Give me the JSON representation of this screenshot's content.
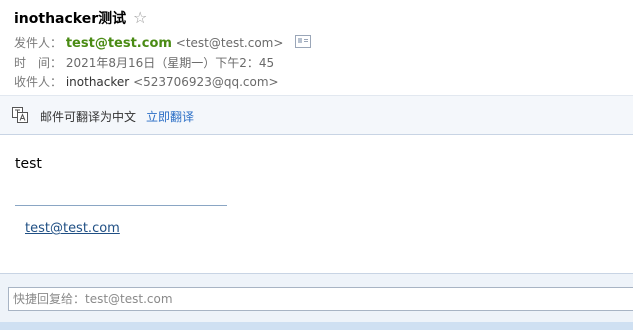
{
  "email": {
    "subject": "inothacker测试",
    "star_glyph": "☆",
    "from_label": "发件人：",
    "from_name": "test@test.com",
    "from_address": "<test@test.com>",
    "time_label": "时　间：",
    "time_value": "2021年8月16日（星期一）下午2：45",
    "to_label": "收件人：",
    "to_name": "inothacker",
    "to_address": "<523706923@qq.com>",
    "contact_card_icon": "contact-card-icon"
  },
  "translate_bar": {
    "icon": "translate-icon",
    "text": "邮件可翻译为中文",
    "action_label": "立即翻译"
  },
  "body": {
    "text": "test",
    "signature_link": "test@test.com"
  },
  "quick_reply": {
    "placeholder": "快捷回复给：test@test.com"
  },
  "colors": {
    "sender_green": "#4a8b14",
    "link_blue": "#2a6ec6",
    "signature_link": "#1f4f84"
  }
}
